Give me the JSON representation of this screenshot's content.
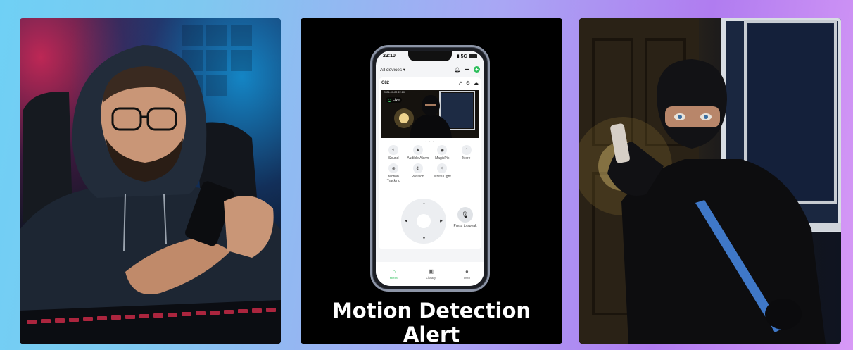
{
  "caption": "Motion Detection Alert",
  "phone": {
    "time": "22:10",
    "signal": "5G",
    "device_filter": "All devices",
    "device_name": "C82",
    "live_label": "Live",
    "timestamp": "2024-01-20 22:10",
    "controls": [
      {
        "icon": "speaker-icon",
        "label": "Sound"
      },
      {
        "icon": "siren-icon",
        "label": "Audible Alarm"
      },
      {
        "icon": "magicpix-icon",
        "label": "MagicPix"
      },
      {
        "icon": "chevron-up-icon",
        "label": "More"
      },
      {
        "icon": "motion-tracking-icon",
        "label": "Motion Tracking"
      },
      {
        "icon": "position-icon",
        "label": "Position"
      },
      {
        "icon": "light-bulb-icon",
        "label": "White Light"
      }
    ],
    "press_to_speak": "Press to speak",
    "tabs": [
      {
        "icon": "home-icon",
        "label": "Home",
        "active": true
      },
      {
        "icon": "library-icon",
        "label": "Library",
        "active": false
      },
      {
        "icon": "user-icon",
        "label": "User",
        "active": false
      }
    ]
  },
  "colors": {
    "accent_green": "#2fbf5d",
    "background_left": "#6fd0f5",
    "background_right": "#d89af6"
  }
}
